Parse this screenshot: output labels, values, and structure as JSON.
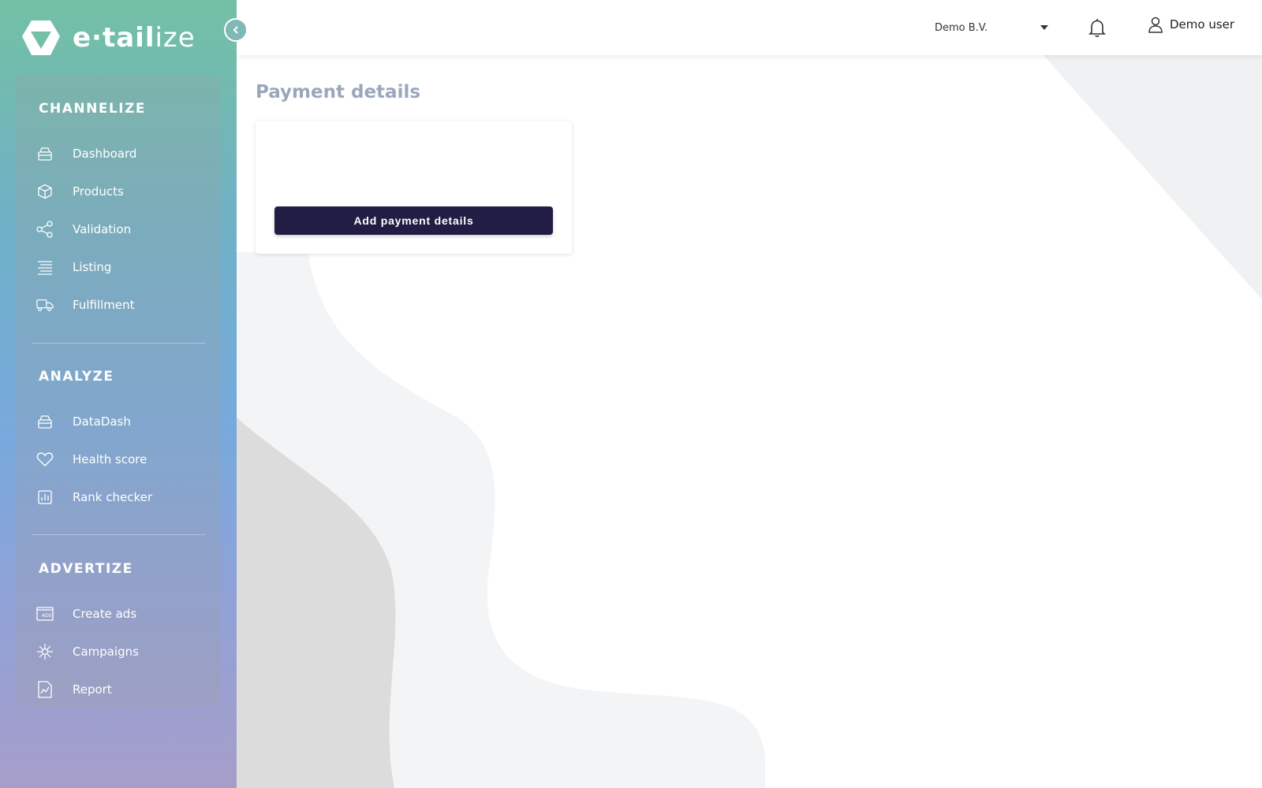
{
  "brand": {
    "logo_text_bold": "e·tail",
    "logo_text_light": "ize"
  },
  "sidebar": {
    "sections": [
      {
        "title": "CHANNELIZE",
        "items": [
          {
            "label": "Dashboard",
            "icon": "dashboard-icon"
          },
          {
            "label": "Products",
            "icon": "box-icon"
          },
          {
            "label": "Validation",
            "icon": "share-nodes-icon"
          },
          {
            "label": "Listing",
            "icon": "list-icon"
          },
          {
            "label": "Fulfillment",
            "icon": "truck-icon"
          }
        ]
      },
      {
        "title": "ANALYZE",
        "items": [
          {
            "label": "DataDash",
            "icon": "dashboard-icon"
          },
          {
            "label": "Health score",
            "icon": "heart-icon"
          },
          {
            "label": "Rank checker",
            "icon": "bar-chart-icon"
          }
        ]
      },
      {
        "title": "ADVERTIZE",
        "items": [
          {
            "label": "Create ads",
            "icon": "ads-icon"
          },
          {
            "label": "Campaigns",
            "icon": "network-icon"
          },
          {
            "label": "Report",
            "icon": "report-icon"
          }
        ]
      }
    ]
  },
  "topbar": {
    "company": "Demo B.V.",
    "user": "Demo user"
  },
  "main": {
    "page_title": "Payment details",
    "add_button_label": "Add payment details"
  },
  "colors": {
    "primary_button": "#221d44",
    "page_title": "#9aa7bb",
    "sidebar_top": "#73c0a4",
    "sidebar_bottom": "#a69ec9"
  }
}
